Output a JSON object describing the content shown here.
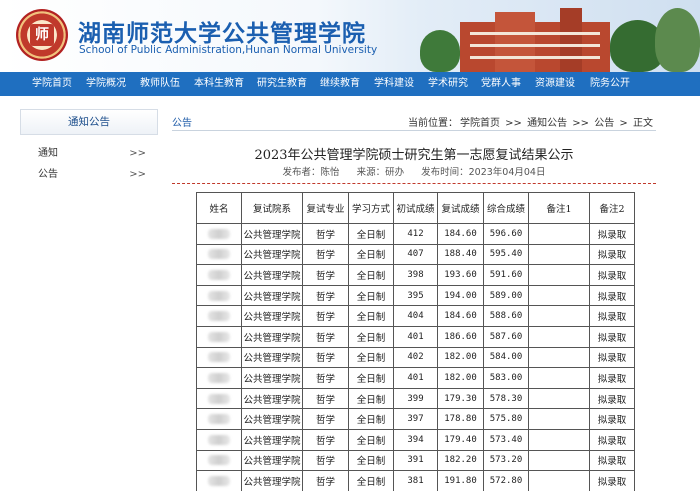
{
  "header": {
    "title_cn": "湖南师范大学公共管理学院",
    "title_en": "School of Public Administration,Hunan Normal University"
  },
  "nav": {
    "items": [
      "学院首页",
      "学院概况",
      "教师队伍",
      "本科生教育",
      "研究生教育",
      "继续教育",
      "学科建设",
      "学术研究",
      "党群人事",
      "资源建设",
      "院务公开"
    ]
  },
  "sidebar": {
    "title": "通知公告",
    "items": [
      {
        "label": "通知",
        "arrow": ">>"
      },
      {
        "label": "公告",
        "arrow": ">>"
      }
    ]
  },
  "content": {
    "tab": "公告",
    "breadcrumb": {
      "prefix": "当前位置：",
      "parts": [
        "学院首页",
        ">>",
        "通知公告",
        ">>",
        "公告",
        ">",
        "正文"
      ]
    },
    "article": {
      "title": "2023年公共管理学院硕士研究生第一志愿复试结果公示",
      "author": "发布者：陈怡",
      "source": "来源：研办",
      "time": "发布时间：2023年04月04日"
    },
    "table": {
      "headers": [
        "姓名",
        "复试院系",
        "复试专业",
        "学习方式",
        "初试成绩",
        "复试成绩",
        "综合成绩",
        "备注1",
        "备注2"
      ],
      "rows": [
        [
          "",
          "公共管理学院",
          "哲学",
          "全日制",
          "412",
          "184.60",
          "596.60",
          "",
          "拟录取"
        ],
        [
          "",
          "公共管理学院",
          "哲学",
          "全日制",
          "407",
          "188.40",
          "595.40",
          "",
          "拟录取"
        ],
        [
          "",
          "公共管理学院",
          "哲学",
          "全日制",
          "398",
          "193.60",
          "591.60",
          "",
          "拟录取"
        ],
        [
          "",
          "公共管理学院",
          "哲学",
          "全日制",
          "395",
          "194.00",
          "589.00",
          "",
          "拟录取"
        ],
        [
          "",
          "公共管理学院",
          "哲学",
          "全日制",
          "404",
          "184.60",
          "588.60",
          "",
          "拟录取"
        ],
        [
          "",
          "公共管理学院",
          "哲学",
          "全日制",
          "401",
          "186.60",
          "587.60",
          "",
          "拟录取"
        ],
        [
          "",
          "公共管理学院",
          "哲学",
          "全日制",
          "402",
          "182.00",
          "584.00",
          "",
          "拟录取"
        ],
        [
          "",
          "公共管理学院",
          "哲学",
          "全日制",
          "401",
          "182.00",
          "583.00",
          "",
          "拟录取"
        ],
        [
          "",
          "公共管理学院",
          "哲学",
          "全日制",
          "399",
          "179.30",
          "578.30",
          "",
          "拟录取"
        ],
        [
          "",
          "公共管理学院",
          "哲学",
          "全日制",
          "397",
          "178.80",
          "575.80",
          "",
          "拟录取"
        ],
        [
          "",
          "公共管理学院",
          "哲学",
          "全日制",
          "394",
          "179.40",
          "573.40",
          "",
          "拟录取"
        ],
        [
          "",
          "公共管理学院",
          "哲学",
          "全日制",
          "391",
          "182.20",
          "573.20",
          "",
          "拟录取"
        ],
        [
          "",
          "公共管理学院",
          "哲学",
          "全日制",
          "381",
          "191.80",
          "572.80",
          "",
          "拟录取"
        ]
      ]
    }
  },
  "colors": {
    "nav_bg": "#1f6fc0",
    "title_blue": "#1b5fb0",
    "divider_red": "#c0392b"
  }
}
